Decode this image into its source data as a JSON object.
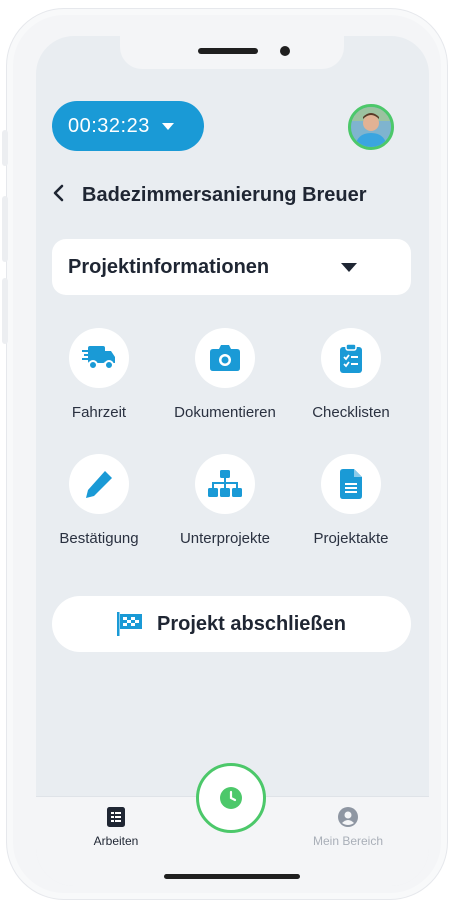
{
  "timer": {
    "value": "00:32:23"
  },
  "header": {
    "title": "Badezimmersanierung Breuer"
  },
  "dropdown": {
    "label": "Projektinformationen"
  },
  "actions": [
    {
      "label": "Fahrzeit",
      "icon": "truck-icon"
    },
    {
      "label": "Dokumentieren",
      "icon": "camera-icon"
    },
    {
      "label": "Checklisten",
      "icon": "clipboard-check-icon"
    },
    {
      "label": "Bestätigung",
      "icon": "pencil-icon"
    },
    {
      "label": "Unterprojekte",
      "icon": "sitemap-icon"
    },
    {
      "label": "Projektakte",
      "icon": "file-icon"
    }
  ],
  "finish_button": {
    "label": "Projekt abschließen",
    "icon": "checkered-flag-icon"
  },
  "tabbar": {
    "items": [
      {
        "label": "Arbeiten",
        "icon": "list-icon",
        "active": true
      },
      {
        "label": "Mein Bereich",
        "icon": "user-circle-icon",
        "active": false
      }
    ],
    "center_icon": "clock-icon"
  },
  "colors": {
    "accent": "#1a9ad6",
    "green": "#4cc86a",
    "text": "#1f2633",
    "background": "#e9edf1"
  }
}
